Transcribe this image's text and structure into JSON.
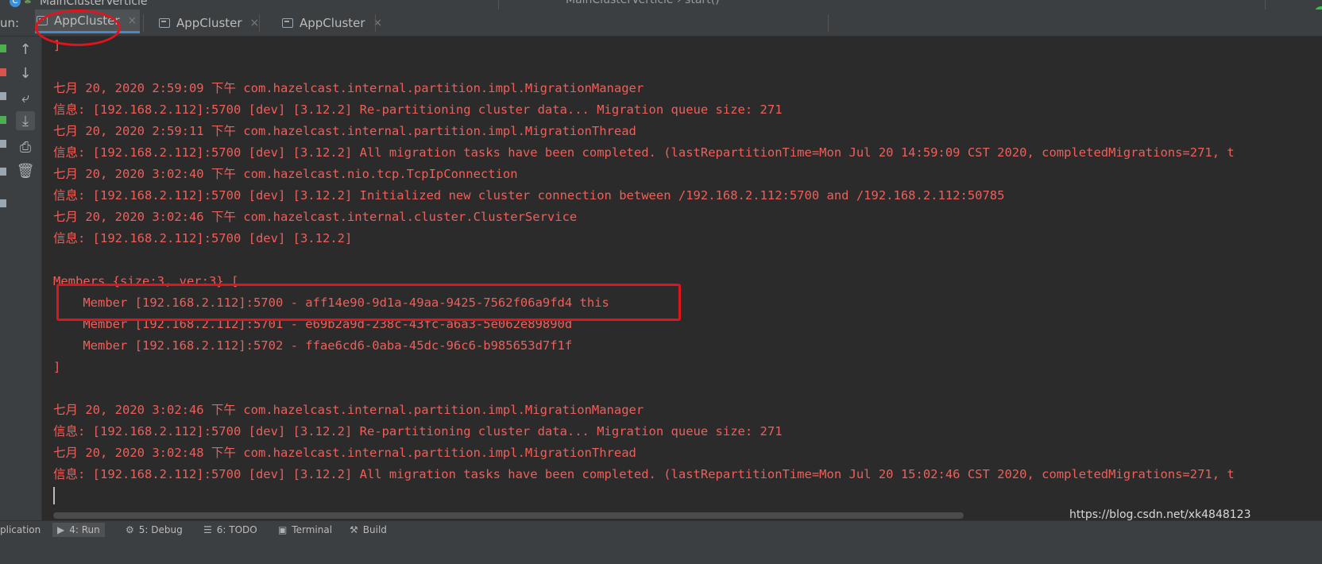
{
  "titlebar": {
    "file_name": "MainClusterVerticle",
    "breadcrumb": "MainClusterVerticle  ›  start()"
  },
  "run_panel": {
    "label": "un:",
    "tabs": [
      {
        "label": "AppCluster",
        "active": true
      },
      {
        "label": "AppCluster",
        "active": false
      },
      {
        "label": "AppCluster",
        "active": false
      }
    ]
  },
  "toolbar": {
    "buttons": [
      "up-arrow-icon",
      "down-arrow-icon",
      "soft-wrap-icon",
      "scroll-to-end-icon",
      "print-icon",
      "trash-icon"
    ]
  },
  "console": {
    "color": "#ef5f5a",
    "lines": [
      "]",
      "",
      "七月 20, 2020 2:59:09 下午 com.hazelcast.internal.partition.impl.MigrationManager",
      "信息: [192.168.2.112]:5700 [dev] [3.12.2] Re-partitioning cluster data... Migration queue size: 271",
      "七月 20, 2020 2:59:11 下午 com.hazelcast.internal.partition.impl.MigrationThread",
      "信息: [192.168.2.112]:5700 [dev] [3.12.2] All migration tasks have been completed. (lastRepartitionTime=Mon Jul 20 14:59:09 CST 2020, completedMigrations=271, t",
      "七月 20, 2020 3:02:40 下午 com.hazelcast.nio.tcp.TcpIpConnection",
      "信息: [192.168.2.112]:5700 [dev] [3.12.2] Initialized new cluster connection between /192.168.2.112:5700 and /192.168.2.112:50785",
      "七月 20, 2020 3:02:46 下午 com.hazelcast.internal.cluster.ClusterService",
      "信息: [192.168.2.112]:5700 [dev] [3.12.2]",
      "",
      "Members {size:3, ver:3} [",
      "    Member [192.168.2.112]:5700 - aff14e90-9d1a-49aa-9425-7562f06a9fd4 this",
      "    Member [192.168.2.112]:5701 - e69b2a9d-238c-43fc-a6a3-5e062e89890d",
      "    Member [192.168.2.112]:5702 - ffae6cd6-0aba-45dc-96c6-b985653d7f1f",
      "]",
      "",
      "七月 20, 2020 3:02:46 下午 com.hazelcast.internal.partition.impl.MigrationManager",
      "信息: [192.168.2.112]:5700 [dev] [3.12.2] Re-partitioning cluster data... Migration queue size: 271",
      "七月 20, 2020 3:02:48 下午 com.hazelcast.internal.partition.impl.MigrationThread",
      "信息: [192.168.2.112]:5700 [dev] [3.12.2] All migration tasks have been completed. (lastRepartitionTime=Mon Jul 20 15:02:46 CST 2020, completedMigrations=271, t"
    ]
  },
  "bottom_tabs": [
    {
      "label": "plication",
      "icon": ""
    },
    {
      "label": "4: Run",
      "icon": "▶",
      "active": true
    },
    {
      "label": "5: Debug",
      "icon": "⚙"
    },
    {
      "label": "6: TODO",
      "icon": "☰"
    },
    {
      "label": "Terminal",
      "icon": "▣"
    },
    {
      "label": "Build",
      "icon": "⚒"
    }
  ],
  "watermark": "https://blog.csdn.net/xk4848123",
  "annotation_color": "#e0141c"
}
